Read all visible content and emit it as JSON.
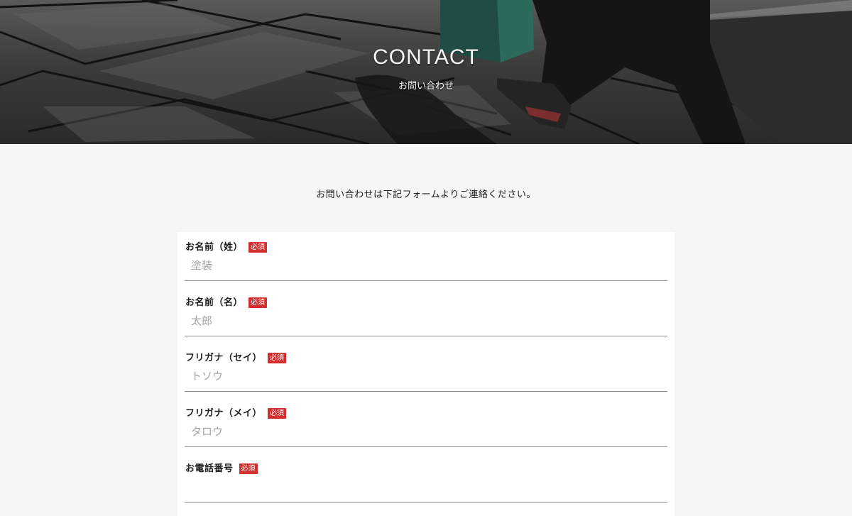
{
  "hero": {
    "title": "CONTACT",
    "subtitle": "お問い合わせ"
  },
  "intro_text": "お問い合わせは下記フォームよりご連絡ください。",
  "required_badge": "必須",
  "colors": {
    "required": "#d32f2f",
    "page_bg": "#f6f6f6",
    "form_bg": "#ffffff",
    "divider": "#8c8c8c",
    "placeholder": "#a3a3a3"
  },
  "form": {
    "fields": [
      {
        "label": "お名前（姓）",
        "placeholder": "塗装",
        "value": ""
      },
      {
        "label": "お名前（名）",
        "placeholder": "太郎",
        "value": ""
      },
      {
        "label": "フリガナ（セイ）",
        "placeholder": "トソウ",
        "value": ""
      },
      {
        "label": "フリガナ（メイ）",
        "placeholder": "タロウ",
        "value": ""
      },
      {
        "label": "お電話番号",
        "placeholder": "",
        "value": ""
      }
    ]
  }
}
